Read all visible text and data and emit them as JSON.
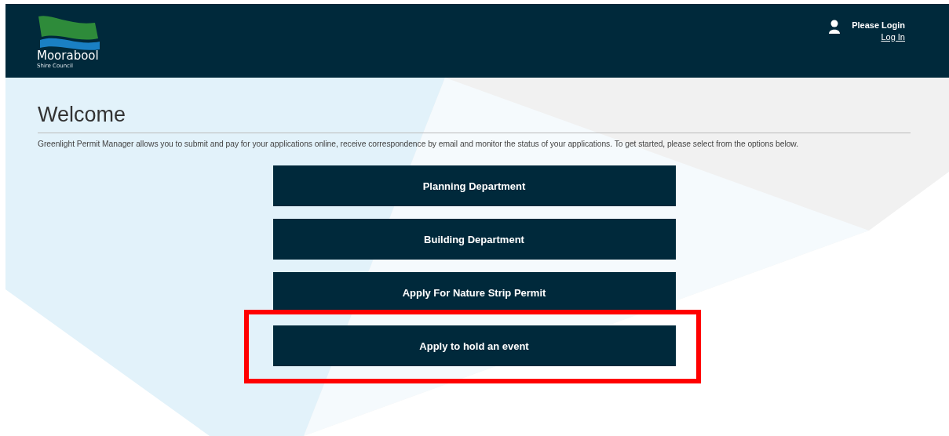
{
  "header": {
    "logo": {
      "name": "Moorabool",
      "subtitle": "Shire Council"
    },
    "user": {
      "status": "Please Login",
      "link": "Log In"
    }
  },
  "page": {
    "title": "Welcome",
    "intro": "Greenlight Permit Manager allows you to submit and pay for your applications online, receive correspondence by email and monitor the status of your applications. To get started, please select from the options below."
  },
  "options": [
    {
      "label": "Planning Department",
      "highlighted": false
    },
    {
      "label": "Building Department",
      "highlighted": false
    },
    {
      "label": "Apply For Nature Strip Permit",
      "highlighted": false
    },
    {
      "label": "Apply to hold an event",
      "highlighted": true
    }
  ]
}
